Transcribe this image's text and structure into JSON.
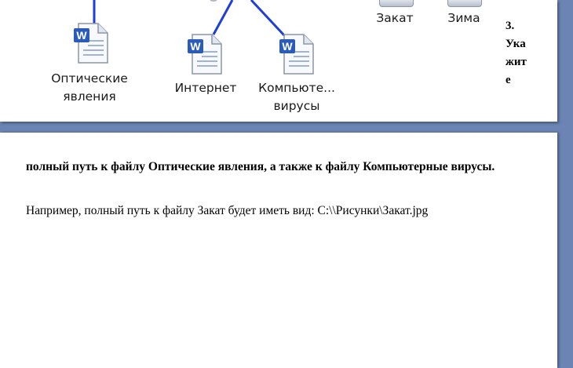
{
  "files": [
    {
      "name": "Закат"
    },
    {
      "name": "Зима"
    },
    {
      "name": "Оптические\nявления"
    },
    {
      "name": "Интернет"
    },
    {
      "name": "Компьюте...\nвирусы"
    }
  ],
  "side_note": "3.\nУка\nжит\nе",
  "task_text": "полный путь к файлу Оптические явления, а также к файлу Компьютерные вирусы.",
  "example_text": "Например, полный путь к файлу Закат будет иметь вид:  C:\\\\Рисунки\\Закат.jpg",
  "colors": {
    "background": "#6b84b4",
    "connector": "#1f3ed6",
    "word_blue": "#2a5bb8"
  }
}
